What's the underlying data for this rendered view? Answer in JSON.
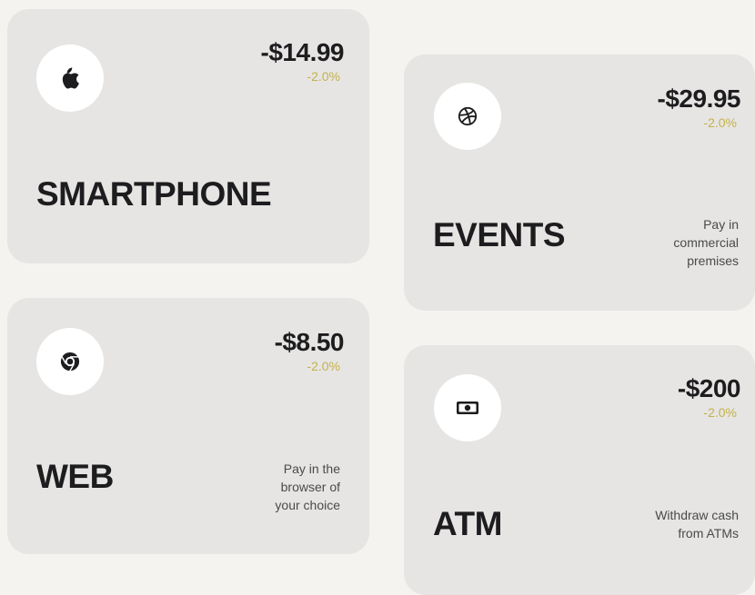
{
  "accent_color": "#c4b24a",
  "cards": [
    {
      "id": "smartphone",
      "icon": "apple-icon",
      "amount": "-$14.99",
      "change": "-2.0%",
      "title": "SMARTPHONE",
      "description": ""
    },
    {
      "id": "events",
      "icon": "dribbble-icon",
      "amount": "-$29.95",
      "change": "-2.0%",
      "title": "EVENTS",
      "description": "Pay in\ncommercial\npremises"
    },
    {
      "id": "web",
      "icon": "chrome-icon",
      "amount": "-$8.50",
      "change": "-2.0%",
      "title": "WEB",
      "description": "Pay in the\nbrowser of\nyour choice"
    },
    {
      "id": "atm",
      "icon": "banknote-icon",
      "amount": "-$200",
      "change": "-2.0%",
      "title": "ATM",
      "description": "Withdraw cash\nfrom ATMs"
    }
  ]
}
